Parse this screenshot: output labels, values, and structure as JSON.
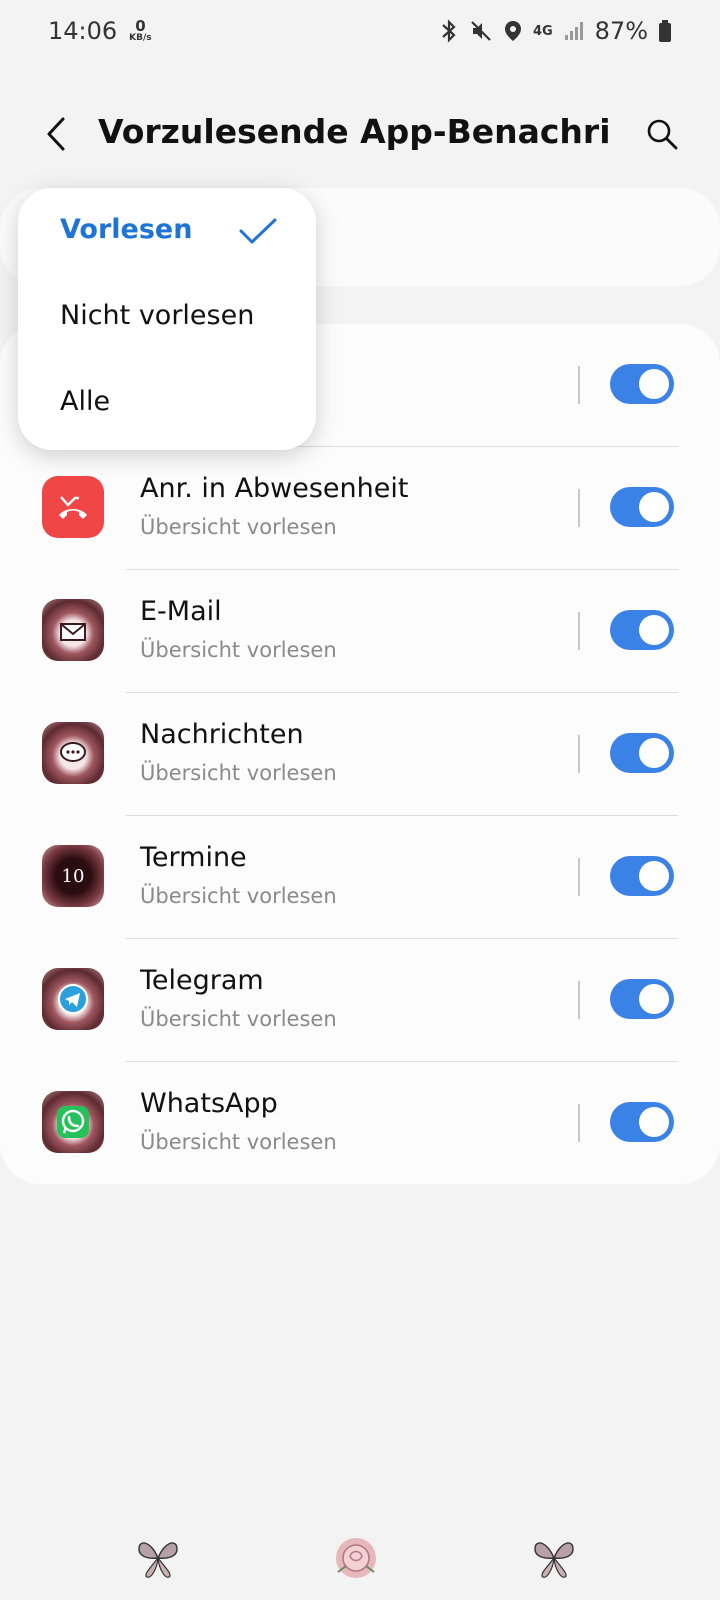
{
  "status_bar": {
    "time": "14:06",
    "data_rate_value": "0",
    "data_rate_unit": "KB/s",
    "network": "4G",
    "battery": "87%"
  },
  "header": {
    "title": "Vorzulesende App-Benachrichti…",
    "back_icon": "chevron-left-icon",
    "search_icon": "search-icon"
  },
  "dropdown": {
    "options": [
      {
        "label": "Vorlesen",
        "selected": true
      },
      {
        "label": "Nicht vorlesen",
        "selected": false
      },
      {
        "label": "Alle",
        "selected": false
      }
    ]
  },
  "apps": [
    {
      "name": "Anr. in Abwesenheit",
      "subtitle": "Übersicht vorlesen",
      "enabled": true,
      "icon": "missed-call-icon"
    },
    {
      "name": "E-Mail",
      "subtitle": "Übersicht vorlesen",
      "enabled": true,
      "icon": "email-icon"
    },
    {
      "name": "Nachrichten",
      "subtitle": "Übersicht vorlesen",
      "enabled": true,
      "icon": "messages-icon"
    },
    {
      "name": "Termine",
      "subtitle": "Übersicht vorlesen",
      "enabled": true,
      "icon": "calendar-icon",
      "badge": "10"
    },
    {
      "name": "Telegram",
      "subtitle": "Übersicht vorlesen",
      "enabled": true,
      "icon": "telegram-icon"
    },
    {
      "name": "WhatsApp",
      "subtitle": "Übersicht vorlesen",
      "enabled": true,
      "icon": "whatsapp-icon"
    }
  ],
  "colors": {
    "accent": "#3b82e6",
    "selected_text": "#1d74d6",
    "missed_call": "#f04646"
  }
}
